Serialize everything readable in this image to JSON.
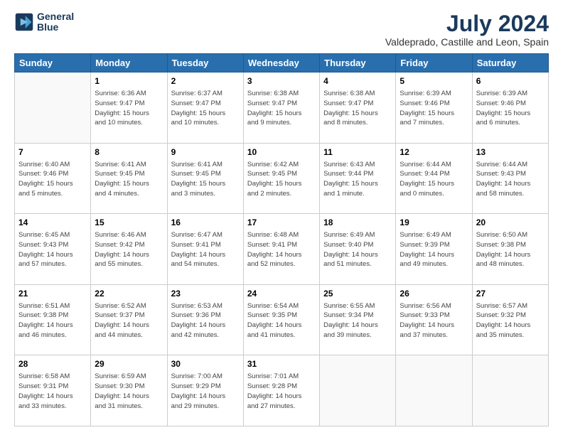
{
  "logo": {
    "line1": "General",
    "line2": "Blue"
  },
  "title": "July 2024",
  "subtitle": "Valdeprado, Castille and Leon, Spain",
  "days_header": [
    "Sunday",
    "Monday",
    "Tuesday",
    "Wednesday",
    "Thursday",
    "Friday",
    "Saturday"
  ],
  "weeks": [
    [
      {
        "num": "",
        "info": ""
      },
      {
        "num": "1",
        "info": "Sunrise: 6:36 AM\nSunset: 9:47 PM\nDaylight: 15 hours\nand 10 minutes."
      },
      {
        "num": "2",
        "info": "Sunrise: 6:37 AM\nSunset: 9:47 PM\nDaylight: 15 hours\nand 10 minutes."
      },
      {
        "num": "3",
        "info": "Sunrise: 6:38 AM\nSunset: 9:47 PM\nDaylight: 15 hours\nand 9 minutes."
      },
      {
        "num": "4",
        "info": "Sunrise: 6:38 AM\nSunset: 9:47 PM\nDaylight: 15 hours\nand 8 minutes."
      },
      {
        "num": "5",
        "info": "Sunrise: 6:39 AM\nSunset: 9:46 PM\nDaylight: 15 hours\nand 7 minutes."
      },
      {
        "num": "6",
        "info": "Sunrise: 6:39 AM\nSunset: 9:46 PM\nDaylight: 15 hours\nand 6 minutes."
      }
    ],
    [
      {
        "num": "7",
        "info": "Sunrise: 6:40 AM\nSunset: 9:46 PM\nDaylight: 15 hours\nand 5 minutes."
      },
      {
        "num": "8",
        "info": "Sunrise: 6:41 AM\nSunset: 9:45 PM\nDaylight: 15 hours\nand 4 minutes."
      },
      {
        "num": "9",
        "info": "Sunrise: 6:41 AM\nSunset: 9:45 PM\nDaylight: 15 hours\nand 3 minutes."
      },
      {
        "num": "10",
        "info": "Sunrise: 6:42 AM\nSunset: 9:45 PM\nDaylight: 15 hours\nand 2 minutes."
      },
      {
        "num": "11",
        "info": "Sunrise: 6:43 AM\nSunset: 9:44 PM\nDaylight: 15 hours\nand 1 minute."
      },
      {
        "num": "12",
        "info": "Sunrise: 6:44 AM\nSunset: 9:44 PM\nDaylight: 15 hours\nand 0 minutes."
      },
      {
        "num": "13",
        "info": "Sunrise: 6:44 AM\nSunset: 9:43 PM\nDaylight: 14 hours\nand 58 minutes."
      }
    ],
    [
      {
        "num": "14",
        "info": "Sunrise: 6:45 AM\nSunset: 9:43 PM\nDaylight: 14 hours\nand 57 minutes."
      },
      {
        "num": "15",
        "info": "Sunrise: 6:46 AM\nSunset: 9:42 PM\nDaylight: 14 hours\nand 55 minutes."
      },
      {
        "num": "16",
        "info": "Sunrise: 6:47 AM\nSunset: 9:41 PM\nDaylight: 14 hours\nand 54 minutes."
      },
      {
        "num": "17",
        "info": "Sunrise: 6:48 AM\nSunset: 9:41 PM\nDaylight: 14 hours\nand 52 minutes."
      },
      {
        "num": "18",
        "info": "Sunrise: 6:49 AM\nSunset: 9:40 PM\nDaylight: 14 hours\nand 51 minutes."
      },
      {
        "num": "19",
        "info": "Sunrise: 6:49 AM\nSunset: 9:39 PM\nDaylight: 14 hours\nand 49 minutes."
      },
      {
        "num": "20",
        "info": "Sunrise: 6:50 AM\nSunset: 9:38 PM\nDaylight: 14 hours\nand 48 minutes."
      }
    ],
    [
      {
        "num": "21",
        "info": "Sunrise: 6:51 AM\nSunset: 9:38 PM\nDaylight: 14 hours\nand 46 minutes."
      },
      {
        "num": "22",
        "info": "Sunrise: 6:52 AM\nSunset: 9:37 PM\nDaylight: 14 hours\nand 44 minutes."
      },
      {
        "num": "23",
        "info": "Sunrise: 6:53 AM\nSunset: 9:36 PM\nDaylight: 14 hours\nand 42 minutes."
      },
      {
        "num": "24",
        "info": "Sunrise: 6:54 AM\nSunset: 9:35 PM\nDaylight: 14 hours\nand 41 minutes."
      },
      {
        "num": "25",
        "info": "Sunrise: 6:55 AM\nSunset: 9:34 PM\nDaylight: 14 hours\nand 39 minutes."
      },
      {
        "num": "26",
        "info": "Sunrise: 6:56 AM\nSunset: 9:33 PM\nDaylight: 14 hours\nand 37 minutes."
      },
      {
        "num": "27",
        "info": "Sunrise: 6:57 AM\nSunset: 9:32 PM\nDaylight: 14 hours\nand 35 minutes."
      }
    ],
    [
      {
        "num": "28",
        "info": "Sunrise: 6:58 AM\nSunset: 9:31 PM\nDaylight: 14 hours\nand 33 minutes."
      },
      {
        "num": "29",
        "info": "Sunrise: 6:59 AM\nSunset: 9:30 PM\nDaylight: 14 hours\nand 31 minutes."
      },
      {
        "num": "30",
        "info": "Sunrise: 7:00 AM\nSunset: 9:29 PM\nDaylight: 14 hours\nand 29 minutes."
      },
      {
        "num": "31",
        "info": "Sunrise: 7:01 AM\nSunset: 9:28 PM\nDaylight: 14 hours\nand 27 minutes."
      },
      {
        "num": "",
        "info": ""
      },
      {
        "num": "",
        "info": ""
      },
      {
        "num": "",
        "info": ""
      }
    ]
  ]
}
